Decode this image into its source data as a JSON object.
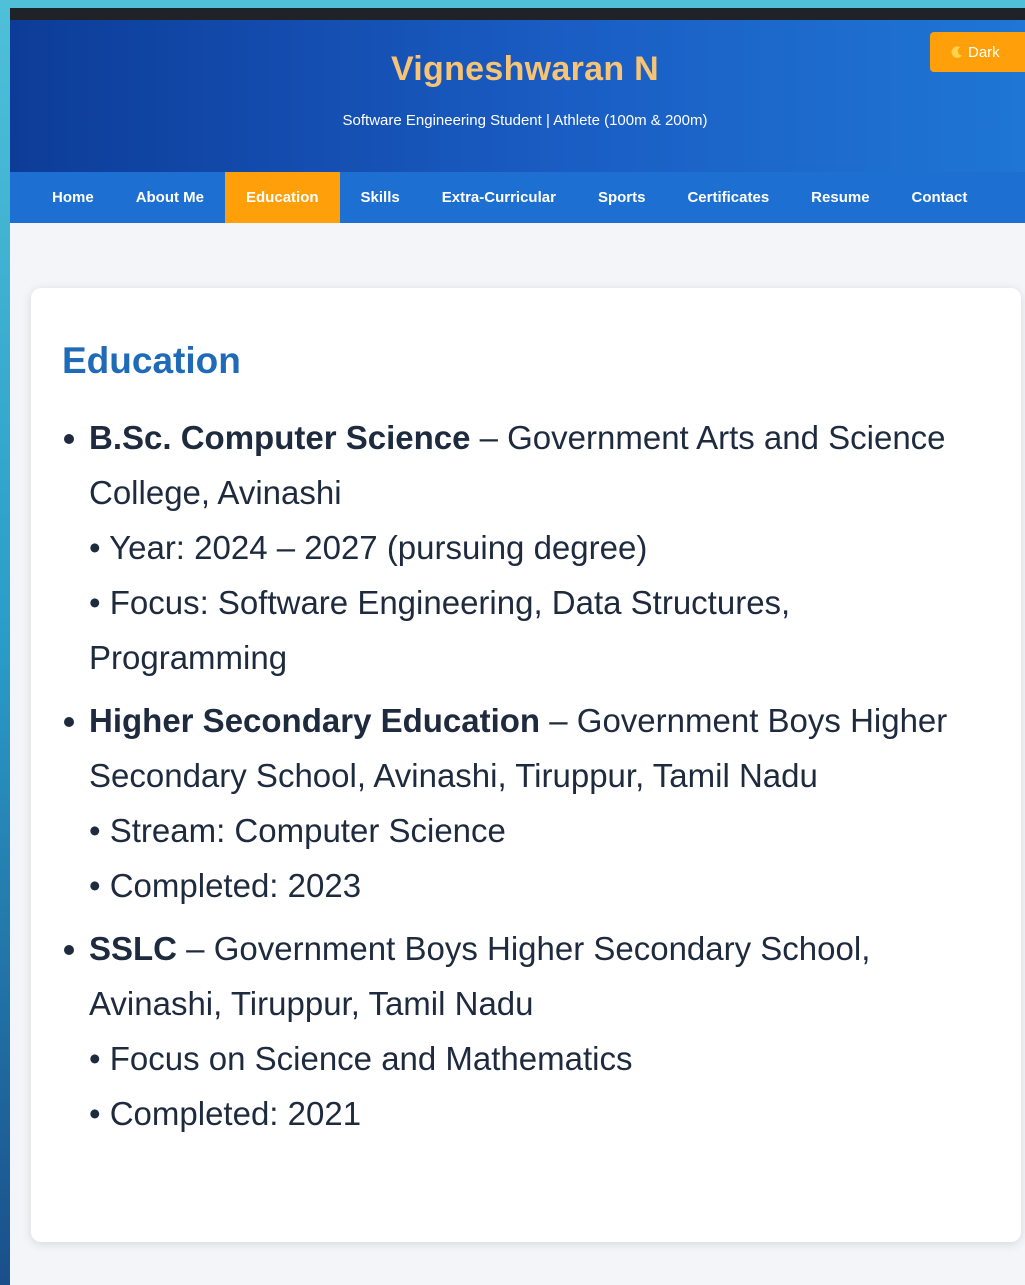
{
  "header": {
    "title": "Vigneshwaran N",
    "subtitle": "Software Engineering Student | Athlete (100m & 200m)",
    "theme_toggle": {
      "icon": "moon-icon",
      "label": "Dark"
    }
  },
  "nav": {
    "items": [
      {
        "label": "Home"
      },
      {
        "label": "About Me"
      },
      {
        "label": "Education",
        "active": true
      },
      {
        "label": "Skills"
      },
      {
        "label": "Extra-Curricular"
      },
      {
        "label": "Sports"
      },
      {
        "label": "Certificates"
      },
      {
        "label": "Resume"
      },
      {
        "label": "Contact"
      }
    ]
  },
  "education": {
    "heading": "Education",
    "entries": [
      {
        "title": "B.Sc. Computer Science",
        "institution": " – Government Arts and Science College, Avinashi",
        "details": [
          "• Year: 2024 – 2027 (pursuing degree)",
          "• Focus: Software Engineering, Data Structures, Programming"
        ]
      },
      {
        "title": "Higher Secondary Education",
        "institution": " – Government Boys Higher Secondary School, Avinashi, Tiruppur, Tamil Nadu",
        "details": [
          "• Stream: Computer Science",
          "• Completed: 2023"
        ]
      },
      {
        "title": "SSLC",
        "institution": " – Government Boys Higher Secondary School, Avinashi, Tiruppur, Tamil Nadu",
        "details": [
          "• Focus on Science and Mathematics",
          "• Completed: 2021"
        ]
      }
    ]
  },
  "colors": {
    "header_gradient_start": "#0d3c98",
    "header_gradient_end": "#1f76d4",
    "title_color": "#f7c476",
    "accent_orange": "#ff9f0a",
    "nav_background": "#1e6fd2",
    "heading_color": "#1f6bb8",
    "body_text": "#1e2a3e"
  }
}
